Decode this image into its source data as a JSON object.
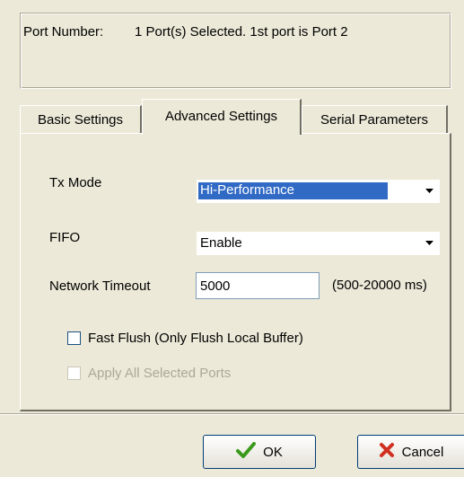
{
  "port": {
    "label": "Port Number:",
    "value": "1 Port(s) Selected. 1st port is Port 2"
  },
  "tabs": [
    {
      "label": "Basic Settings",
      "active": false
    },
    {
      "label": "Advanced Settings",
      "active": true
    },
    {
      "label": "Serial Parameters",
      "active": false
    }
  ],
  "advanced": {
    "tx_mode": {
      "label": "Tx Mode",
      "value": "Hi-Performance"
    },
    "fifo": {
      "label": "FIFO",
      "value": "Enable"
    },
    "network_timeout": {
      "label": "Network Timeout",
      "value": "5000",
      "range": "(500-20000 ms)"
    },
    "fast_flush": {
      "label": "Fast Flush (Only Flush Local Buffer)",
      "checked": false
    },
    "apply_all": {
      "label": "Apply All Selected Ports",
      "checked": false,
      "enabled": false
    }
  },
  "buttons": {
    "ok": "OK",
    "cancel": "Cancel"
  },
  "colors": {
    "background": "#ece9d8",
    "selection": "#316ac5",
    "ok_icon": "#3a9a1c",
    "cancel_icon": "#d03020"
  },
  "icons": {
    "ok": "check-icon",
    "cancel": "x-icon",
    "dropdown": "dropdown-arrow-icon"
  }
}
